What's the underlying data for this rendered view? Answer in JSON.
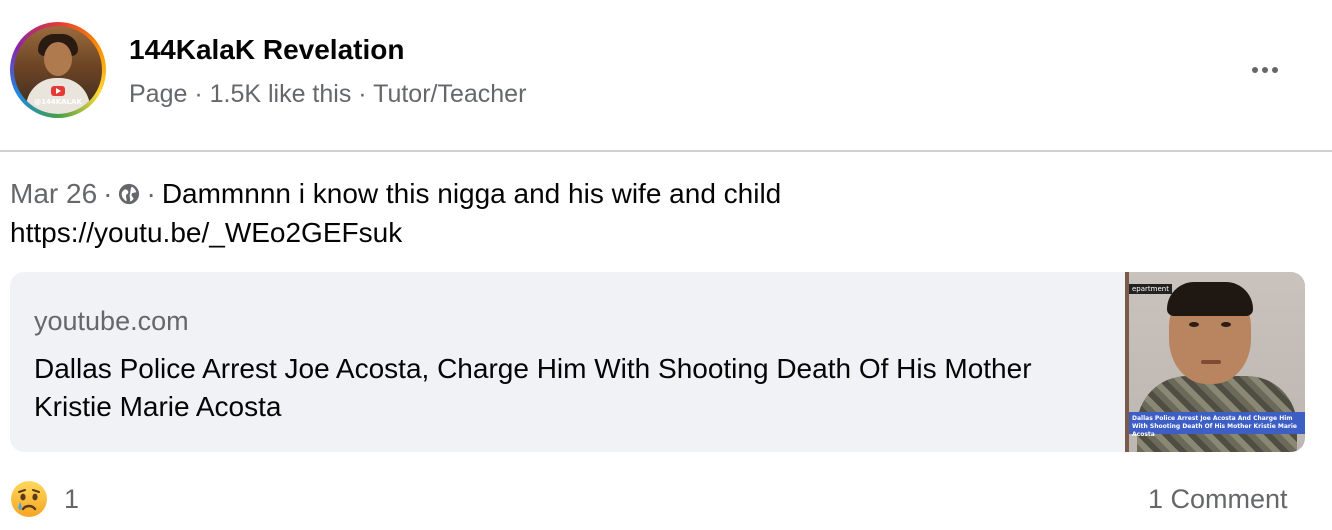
{
  "header": {
    "page_name": "144KalaK Revelation",
    "meta": "Page · 1.5K like this · Tutor/Teacher",
    "avatar_tag": "@144KALAK",
    "more_icon": "more-horizontal-icon"
  },
  "post": {
    "date": "Mar 26",
    "separator": "·",
    "audience_icon": "globe-icon",
    "text": "Dammnnn i know this nigga and his wife and child",
    "url": "https://youtu.be/_WEo2GEFsuk"
  },
  "link_preview": {
    "domain": "youtube.com",
    "title": "Dallas Police Arrest Joe Acosta, Charge Him With Shooting Death Of His Mother Kristie Marie Acosta",
    "thumbnail_label": "epartment",
    "thumbnail_caption": "Dallas Police Arrest Joe Acosta And Charge Him With Shooting Death Of His Mother Kristie Marie Acosta"
  },
  "footer": {
    "reaction_icon": "sad-face-icon",
    "reaction_count": "1",
    "comment_count": "1 Comment"
  },
  "colors": {
    "primary_text": "#050505",
    "secondary_text": "#65676b",
    "card_background": "#f0f2f5",
    "divider": "#ced0d4"
  }
}
